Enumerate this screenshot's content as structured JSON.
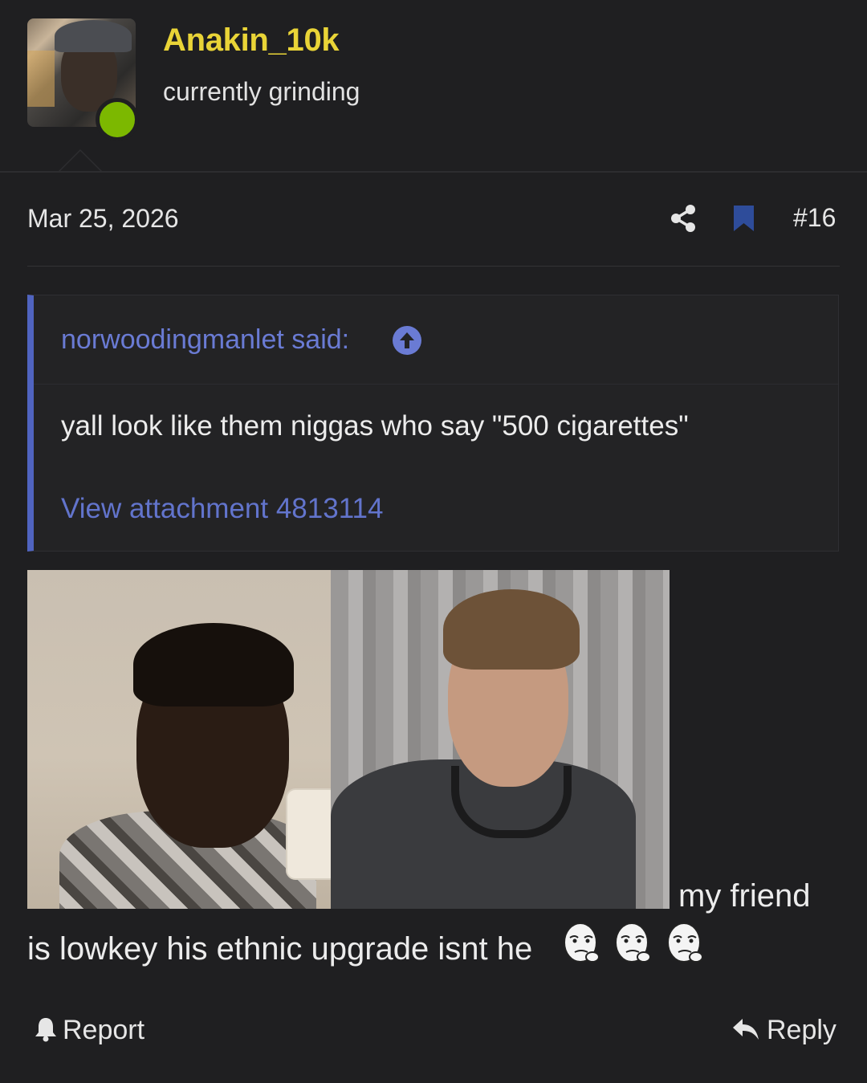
{
  "post": {
    "user": {
      "name": "Anakin_10k",
      "title": "currently grinding",
      "status": "online"
    },
    "date": "Mar 25, 2026",
    "number": "#16",
    "actions": {
      "share_icon": "share-icon",
      "bookmark_icon": "bookmark-icon"
    },
    "quote": {
      "author": "norwoodingmanlet said:",
      "text": "yall look like them niggas who say \"500 cigarettes\"",
      "attachment": "View attachment 4813114"
    },
    "body": {
      "inline_text": "my friend",
      "line2": "is lowkey his ethnic upgrade isnt he",
      "emoji_count": 3
    },
    "footer": {
      "report_label": "Report",
      "reply_label": "Reply"
    },
    "colors": {
      "username": "#e9d437",
      "online": "#7cb800",
      "link": "#6274cc",
      "quote_border": "#5064c0",
      "bookmark": "#2e4c9a"
    }
  }
}
